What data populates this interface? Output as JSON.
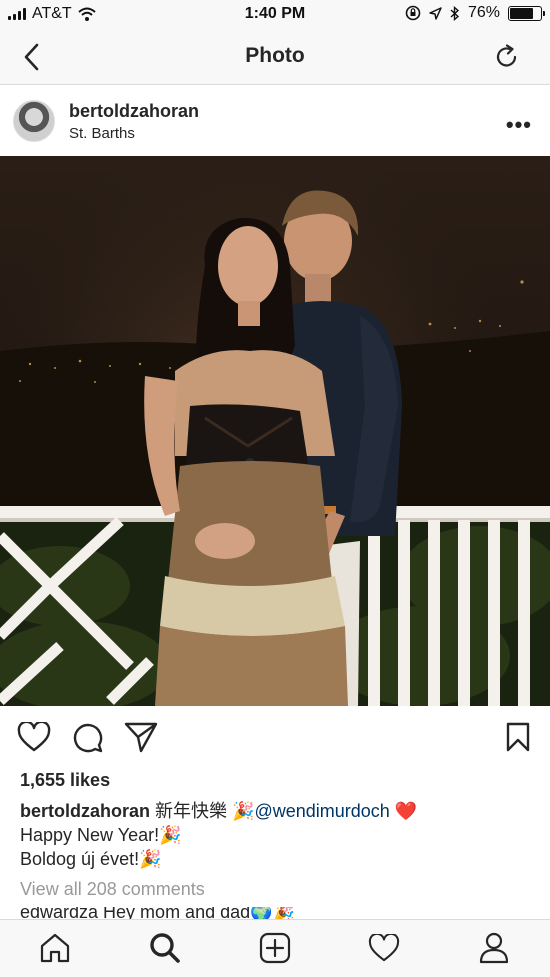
{
  "status_bar": {
    "carrier": "AT&T",
    "time": "1:40 PM",
    "battery": "76%",
    "battery_level": 0.76
  },
  "nav": {
    "title": "Photo",
    "back_icon": "chevron-left-icon",
    "refresh_icon": "refresh-icon"
  },
  "post": {
    "username": "bertoldzahoran",
    "location": "St. Barths",
    "more_label": "•••",
    "likes": "1,655 likes",
    "caption": {
      "username": "bertoldzahoran",
      "text1": "新年快樂 🎉",
      "mention": "@wendimurdoch",
      "heart": "❤️",
      "line2": "Happy New Year!🎉",
      "line3": "Boldog új évet!🎉"
    },
    "view_comments": "View all 208 comments",
    "comment_peek": "edwardza Hey mom and dad🌍🎉"
  },
  "colors": {
    "accent": "#003569",
    "heart": "#ed4956",
    "muted": "#999999",
    "bar_bg": "#f8f8f8"
  },
  "tab_bar": {
    "icons": [
      "home-icon",
      "search-icon",
      "add-post-icon",
      "activity-heart-icon",
      "profile-icon"
    ]
  }
}
